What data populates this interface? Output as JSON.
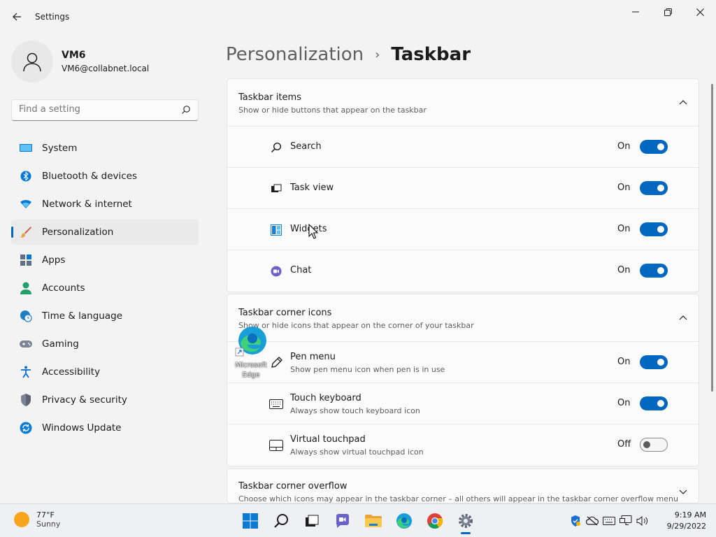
{
  "app": {
    "title": "Settings"
  },
  "profile": {
    "name": "VM6",
    "email": "VM6@collabnet.local"
  },
  "search": {
    "placeholder": "Find a setting"
  },
  "nav": {
    "items": [
      {
        "label": "System",
        "icon": "monitor-icon"
      },
      {
        "label": "Bluetooth & devices",
        "icon": "bluetooth-icon"
      },
      {
        "label": "Network & internet",
        "icon": "wifi-icon"
      },
      {
        "label": "Personalization",
        "icon": "brush-icon",
        "active": true
      },
      {
        "label": "Apps",
        "icon": "apps-icon"
      },
      {
        "label": "Accounts",
        "icon": "person-icon"
      },
      {
        "label": "Time & language",
        "icon": "globe-clock-icon"
      },
      {
        "label": "Gaming",
        "icon": "gamepad-icon"
      },
      {
        "label": "Accessibility",
        "icon": "accessibility-icon"
      },
      {
        "label": "Privacy & security",
        "icon": "shield-icon"
      },
      {
        "label": "Windows Update",
        "icon": "update-icon"
      }
    ]
  },
  "breadcrumb": {
    "parent": "Personalization",
    "separator": "›",
    "current": "Taskbar"
  },
  "sections": {
    "items": {
      "title": "Taskbar items",
      "subtitle": "Show or hide buttons that appear on the taskbar",
      "rows": [
        {
          "label": "Search",
          "state": "On",
          "on": true,
          "icon": "search-icon"
        },
        {
          "label": "Task view",
          "state": "On",
          "on": true,
          "icon": "task-view-icon"
        },
        {
          "label": "Widgets",
          "state": "On",
          "on": true,
          "icon": "widgets-icon"
        },
        {
          "label": "Chat",
          "state": "On",
          "on": true,
          "icon": "chat-icon"
        }
      ]
    },
    "corner": {
      "title": "Taskbar corner icons",
      "subtitle": "Show or hide icons that appear on the corner of your taskbar",
      "rows": [
        {
          "label": "Pen menu",
          "sub": "Show pen menu icon when pen is in use",
          "state": "On",
          "on": true,
          "icon": "pen-icon"
        },
        {
          "label": "Touch keyboard",
          "sub": "Always show touch keyboard icon",
          "state": "On",
          "on": true,
          "icon": "keyboard-icon"
        },
        {
          "label": "Virtual touchpad",
          "sub": "Always show virtual touchpad icon",
          "state": "Off",
          "on": false,
          "icon": "touchpad-icon"
        }
      ]
    },
    "overflow": {
      "title": "Taskbar corner overflow",
      "subtitle": "Choose which icons may appear in the taskbar corner – all others will appear in the taskbar corner overflow menu"
    }
  },
  "desktop_icon": {
    "label": "Microsoft Edge"
  },
  "taskbar": {
    "weather": {
      "temp": "77°F",
      "condition": "Sunny"
    },
    "clock": {
      "time": "9:19 AM",
      "date": "9/29/2022"
    }
  },
  "colors": {
    "accent": "#0067c0",
    "background": "#f3f3f3",
    "card": "#fbfbfb"
  }
}
